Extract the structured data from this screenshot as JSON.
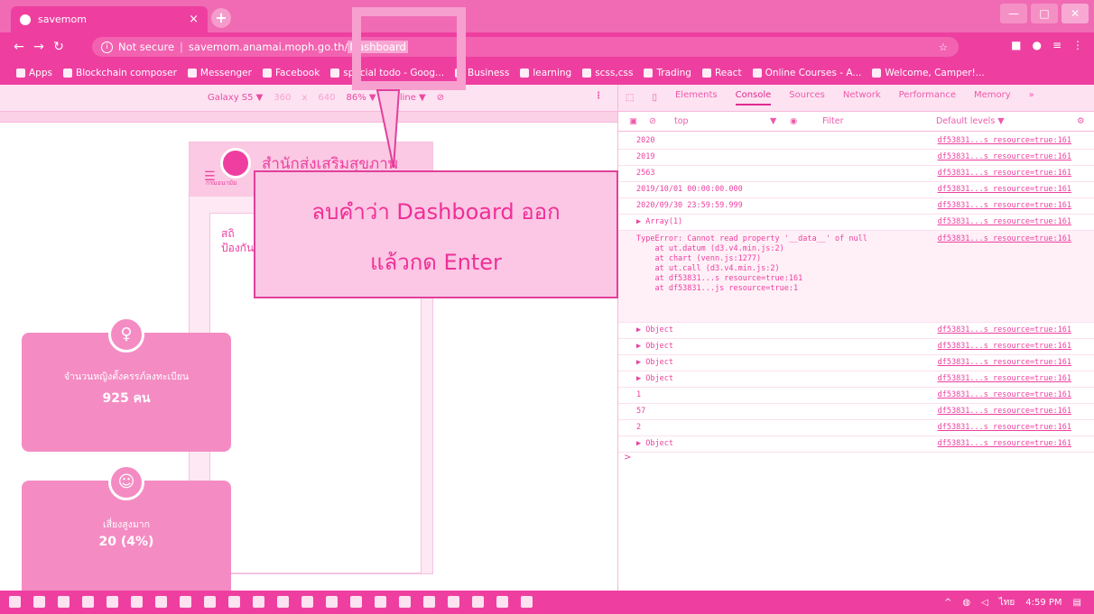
{
  "browser": {
    "tab_title": "savemom",
    "tab_close": "×",
    "new_tab": "+",
    "url_security": "Not secure",
    "url_host": "savemom.anamai.moph.go.th/",
    "url_path_selected": "Dashboard"
  },
  "bookmarks": [
    "Apps",
    "Blockchain composer",
    "Messenger",
    "Facebook",
    "special todo - Goog...",
    "Business",
    "learning",
    "scss,css",
    "Trading",
    "React",
    "Online Courses - A...",
    "Welcome, Camper!..."
  ],
  "device_toolbar": {
    "device": "Galaxy S5 ▼",
    "width": "360",
    "times": "x",
    "height": "640",
    "zoom": "86% ▼",
    "network": "Online ▼"
  },
  "page": {
    "site_title": "สำนักส่งเสริมสุขภาพ",
    "site_sub": "กรมอนามัย",
    "panel_title_l1": "สถิ",
    "panel_title_l2": "ป้องกัน",
    "stat1_label": "จำนวนหญิงตั้งครรภ์ลงทะเบียน",
    "stat1_value": "925 คน",
    "stat2_label": "เสี่ยงสูงมาก",
    "stat2_value": "20 (4%)"
  },
  "devtools": {
    "tabs": [
      "Elements",
      "Console",
      "Sources",
      "Network",
      "Performance",
      "Memory",
      "»"
    ],
    "context": "top",
    "filter_placeholder": "Filter",
    "levels": "Default levels ▼",
    "source": "df53831...s resource=true:161",
    "logs": [
      "2020",
      "2019",
      "2563",
      "2019/10/01 00:00:00.000",
      "2020/09/30 23:59:59.999",
      "▶ Array(1)"
    ],
    "error_lines": [
      "TypeError: Cannot read property '__data__' of null",
      "    at ut.datum (d3.v4.min.js:2)",
      "    at chart (venn.js:1277)",
      "    at ut.call (d3.v4.min.js:2)",
      "    at df53831...s resource=true:161",
      "    at df53831...js resource=true:1"
    ],
    "logs_after": [
      "▶ Object",
      "▶ Object",
      "▶ Object",
      "▶ Object",
      "1",
      "57",
      "2",
      "▶ Object"
    ],
    "prompt": ">"
  },
  "taskbar": {
    "lang": "ไทย",
    "time": "4:59 PM"
  },
  "annotation": {
    "line1": "ลบคำว่า Dashboard ออก",
    "line2": "แล้วกด Enter"
  },
  "colors": {
    "accent": "#ee3fa0",
    "panel": "#fbc7e4"
  }
}
